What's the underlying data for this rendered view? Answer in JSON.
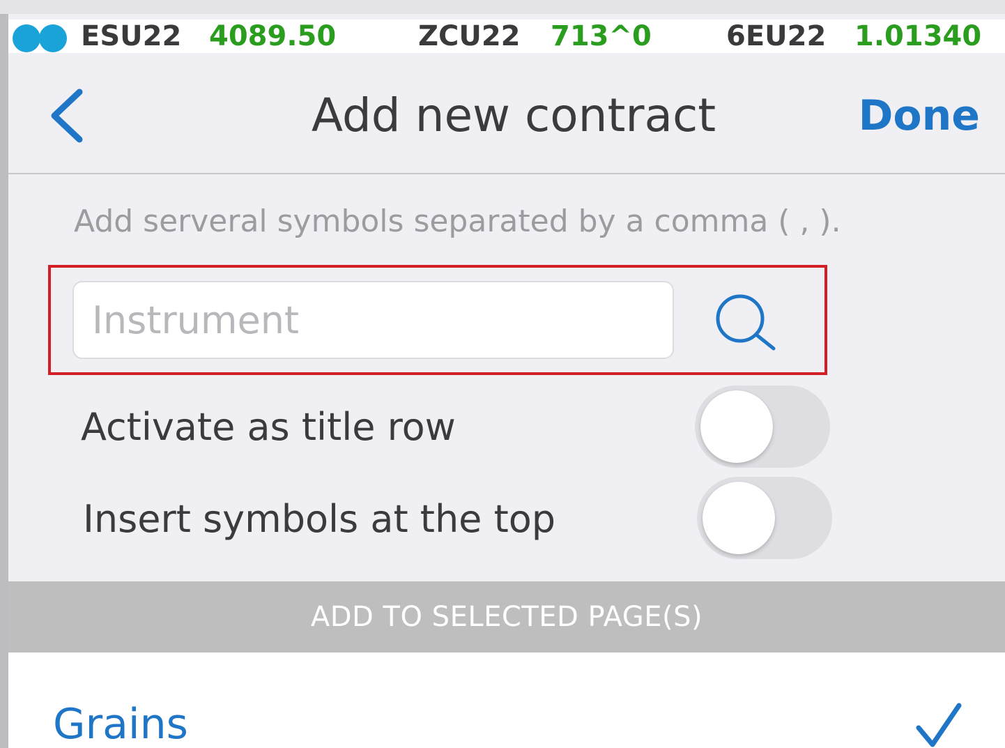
{
  "ticker": {
    "items": [
      {
        "symbol": "ESU22",
        "value": "4089.50"
      },
      {
        "symbol": "ZCU22",
        "value": "713^0"
      },
      {
        "symbol": "6EU22",
        "value": "1.01340"
      }
    ]
  },
  "nav": {
    "title": "Add new contract",
    "done_label": "Done",
    "back_icon": "chevron-left-icon"
  },
  "form": {
    "hint": "Add serveral symbols separated by a comma ( , ).",
    "instrument_placeholder": "Instrument",
    "instrument_value": "",
    "search_icon": "search-icon",
    "toggles": [
      {
        "label": "Activate as title row",
        "on": false
      },
      {
        "label": "Insert symbols at the top",
        "on": false
      }
    ]
  },
  "section": {
    "header": "ADD TO SELECTED PAGE(S)"
  },
  "pages": [
    {
      "name": "Grains",
      "selected": true
    }
  ],
  "colors": {
    "accent": "#1f76c6",
    "price_up": "#2a9d1f",
    "highlight": "#d51f27",
    "ticker_dot": "#1aa3d8"
  }
}
